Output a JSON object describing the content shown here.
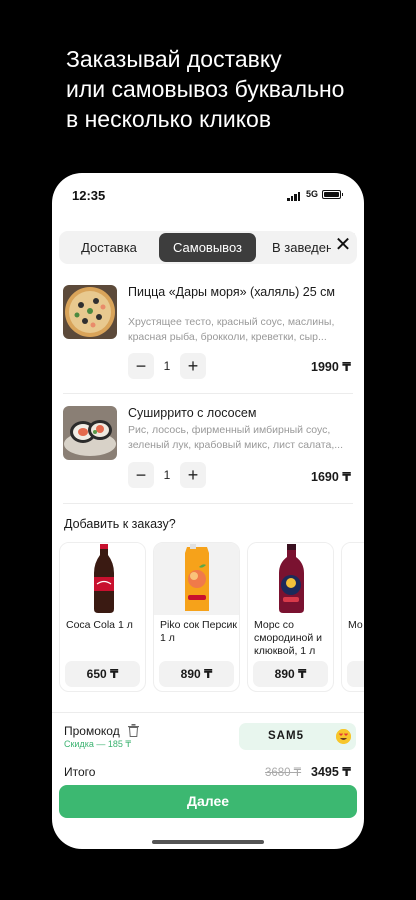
{
  "headline": [
    "Заказывай доставку",
    "или самовывоз буквально",
    "в несколько кликов"
  ],
  "status": {
    "time": "12:35",
    "network": "5G"
  },
  "tabs": [
    {
      "label": "Доставка",
      "active": false
    },
    {
      "label": "Самовывоз",
      "active": true
    },
    {
      "label": "В заведении",
      "active": false
    }
  ],
  "close_label": "✕",
  "cart": [
    {
      "title": "Пицца «Дары моря» (халяль) 25 см",
      "description": "Хрустящее тесто, красный соус, маслины, красная рыба, брокколи, креветки, сыр...",
      "quantity": "1",
      "price": "1990 ₸"
    },
    {
      "title": "Суширрито с лососем",
      "description": "Рис, лосось, фирменный имбирный соус, зеленый лук, крабовый микс, лист салата,...",
      "quantity": "1",
      "price": "1690 ₸"
    }
  ],
  "addons_title": "Добавить к заказу?",
  "addons": [
    {
      "name": "Coca Cola 1 л",
      "price": "650 ₸"
    },
    {
      "name": "Piko сок Персик 1 л",
      "price": "890 ₸"
    },
    {
      "name": "Морс со смородиной и клюквой, 1 л",
      "price": "890 ₸"
    },
    {
      "name": "Мо сме виш",
      "price": ""
    }
  ],
  "promo": {
    "label": "Промокод",
    "discount": "Скидка — 185 ₸",
    "code": "SAM5"
  },
  "total": {
    "label": "Итого",
    "old": "3680 ₸",
    "new": "3495 ₸"
  },
  "next_label": "Далее",
  "colors": {
    "accent": "#3cb871",
    "promo_bg": "#e8f6ee",
    "active_tab": "#3d3d3d"
  }
}
